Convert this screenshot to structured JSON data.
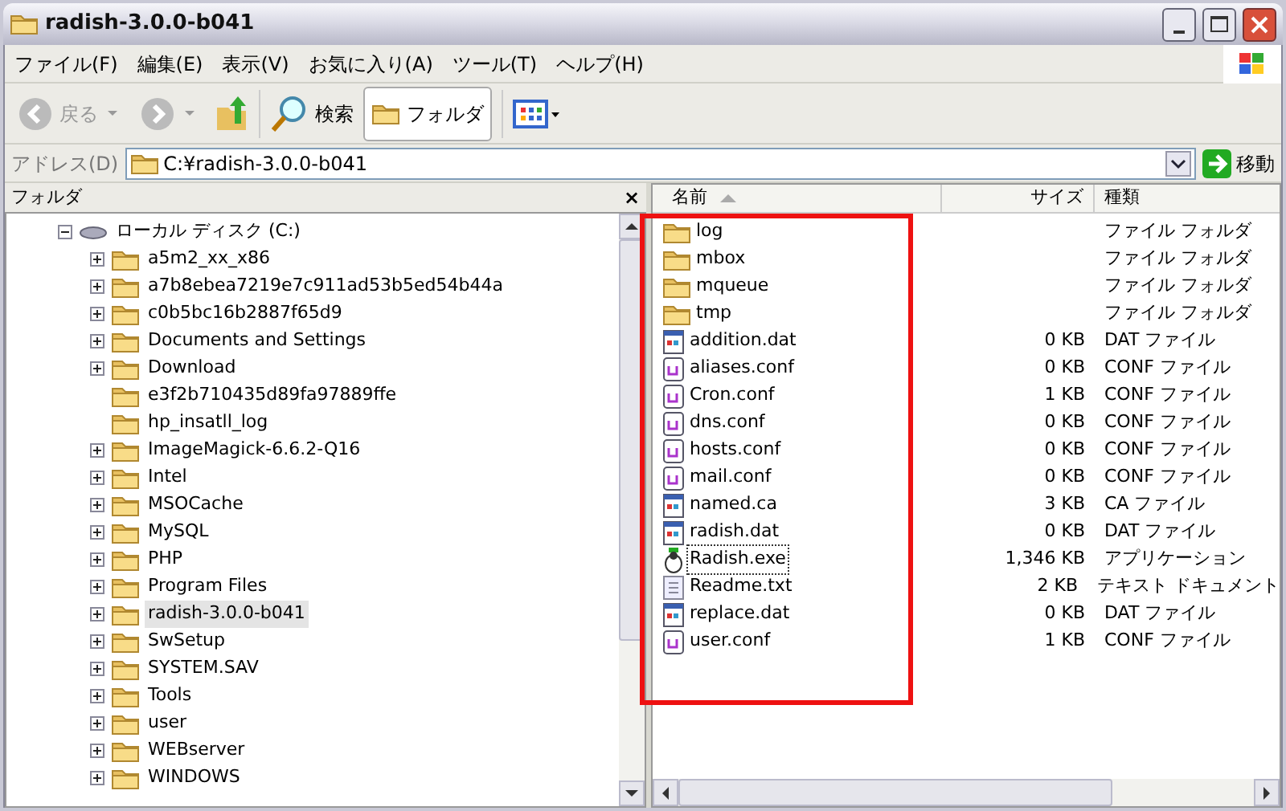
{
  "window": {
    "title": "radish-3.0.0-b041"
  },
  "menu": [
    "ファイル(F)",
    "編集(E)",
    "表示(V)",
    "お気に入り(A)",
    "ツール(T)",
    "ヘルプ(H)"
  ],
  "toolbar": {
    "back": "戻る",
    "search": "検索",
    "folders": "フォルダ"
  },
  "address": {
    "label": "アドレス(D)",
    "value": "C:¥radish-3.0.0-b041",
    "go": "移動"
  },
  "folder_pane": {
    "title": "フォルダ",
    "close": "×",
    "tree": [
      {
        "label": "ローカル ディスク (C:)",
        "expanded": true,
        "selected": false,
        "children": [
          {
            "label": "a5m2_xx_x86",
            "expandable": true,
            "selected": false
          },
          {
            "label": "a7b8ebea7219e7c911ad53b5ed54b44a",
            "expandable": true,
            "selected": false
          },
          {
            "label": "c0b5bc16b2887f65d9",
            "expandable": true,
            "selected": false
          },
          {
            "label": "Documents and Settings",
            "expandable": true,
            "selected": false
          },
          {
            "label": "Download",
            "expandable": true,
            "selected": false
          },
          {
            "label": "e3f2b710435d89fa97889ffe",
            "expandable": false,
            "selected": false
          },
          {
            "label": "hp_insatll_log",
            "expandable": false,
            "selected": false
          },
          {
            "label": "ImageMagick-6.6.2-Q16",
            "expandable": true,
            "selected": false
          },
          {
            "label": "Intel",
            "expandable": true,
            "selected": false
          },
          {
            "label": "MSOCache",
            "expandable": true,
            "selected": false
          },
          {
            "label": "MySQL",
            "expandable": true,
            "selected": false
          },
          {
            "label": "PHP",
            "expandable": true,
            "selected": false
          },
          {
            "label": "Program Files",
            "expandable": true,
            "selected": false
          },
          {
            "label": "radish-3.0.0-b041",
            "expandable": true,
            "selected": true
          },
          {
            "label": "SwSetup",
            "expandable": true,
            "selected": false
          },
          {
            "label": "SYSTEM.SAV",
            "expandable": true,
            "selected": false
          },
          {
            "label": "Tools",
            "expandable": true,
            "selected": false
          },
          {
            "label": "user",
            "expandable": true,
            "selected": false
          },
          {
            "label": "WEBserver",
            "expandable": true,
            "selected": false
          },
          {
            "label": "WINDOWS",
            "expandable": true,
            "selected": false
          }
        ]
      }
    ]
  },
  "file_list": {
    "columns": [
      "名前",
      "サイズ",
      "種類"
    ],
    "rows": [
      {
        "kind": "folder",
        "name": "log",
        "type": "ファイル フォルダ",
        "selected": false
      },
      {
        "kind": "folder",
        "name": "mbox",
        "type": "ファイル フォルダ",
        "selected": false
      },
      {
        "kind": "folder",
        "name": "mqueue",
        "type": "ファイル フォルダ",
        "selected": false
      },
      {
        "kind": "folder",
        "name": "tmp",
        "type": "ファイル フォルダ",
        "selected": false
      },
      {
        "kind": "data",
        "name": "addition.dat",
        "size": "0 KB",
        "type": "DAT ファイル",
        "selected": false
      },
      {
        "kind": "config",
        "name": "aliases.conf",
        "size": "0 KB",
        "type": "CONF ファイル",
        "selected": false
      },
      {
        "kind": "config",
        "name": "Cron.conf",
        "size": "1 KB",
        "type": "CONF ファイル",
        "selected": false
      },
      {
        "kind": "config",
        "name": "dns.conf",
        "size": "0 KB",
        "type": "CONF ファイル",
        "selected": false
      },
      {
        "kind": "config",
        "name": "hosts.conf",
        "size": "0 KB",
        "type": "CONF ファイル",
        "selected": false
      },
      {
        "kind": "config",
        "name": "mail.conf",
        "size": "0 KB",
        "type": "CONF ファイル",
        "selected": false
      },
      {
        "kind": "data",
        "name": "named.ca",
        "size": "3 KB",
        "type": "CA ファイル",
        "selected": false
      },
      {
        "kind": "data",
        "name": "radish.dat",
        "size": "0 KB",
        "type": "DAT ファイル",
        "selected": false
      },
      {
        "kind": "app",
        "name": "Radish.exe",
        "size": "1,346 KB",
        "type": "アプリケーション",
        "selected": true
      },
      {
        "kind": "text",
        "name": "Readme.txt",
        "size": "2 KB",
        "type": "テキスト ドキュメント",
        "selected": false
      },
      {
        "kind": "data",
        "name": "replace.dat",
        "size": "0 KB",
        "type": "DAT ファイル",
        "selected": false
      },
      {
        "kind": "config",
        "name": "user.conf",
        "size": "1 KB",
        "type": "CONF ファイル",
        "selected": false
      }
    ]
  }
}
